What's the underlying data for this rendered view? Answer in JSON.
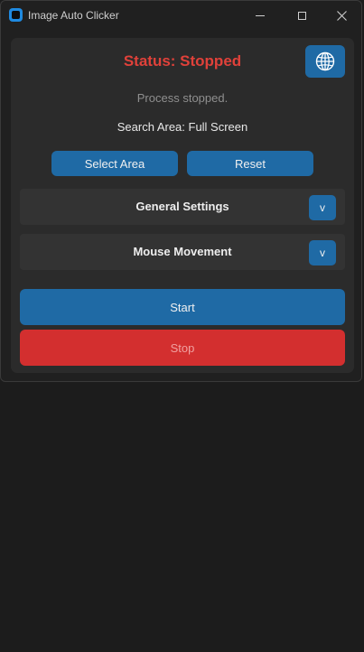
{
  "window": {
    "title": "Image Auto Clicker",
    "controls": [
      "minimize",
      "maximize",
      "close"
    ]
  },
  "status": {
    "text": "Status: Stopped",
    "color": "#e0413a"
  },
  "language_button": {
    "icon": "globe-icon"
  },
  "process_message": "Process stopped.",
  "search_area": "Search Area: Full Screen",
  "area_buttons": {
    "select_label": "Select Area",
    "reset_label": "Reset"
  },
  "sections": [
    {
      "title": "General Settings",
      "toggle_label": "v"
    },
    {
      "title": "Mouse Movement",
      "toggle_label": "v"
    }
  ],
  "actions": {
    "start_label": "Start",
    "stop_label": "Stop"
  },
  "colors": {
    "accent": "#1f6aa5",
    "danger": "#d32f2f",
    "background": "#202020",
    "panel": "#2b2b2b"
  }
}
